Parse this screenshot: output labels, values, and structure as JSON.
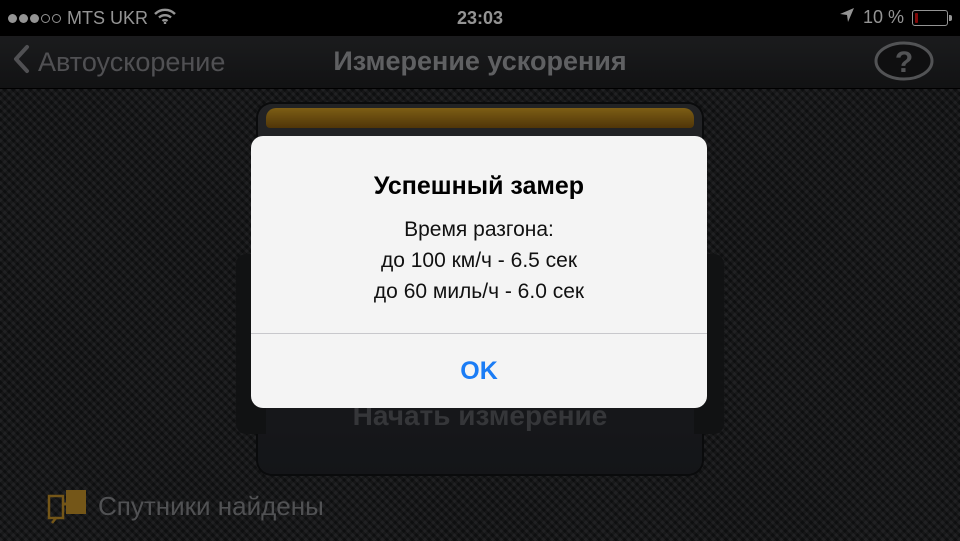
{
  "status_bar": {
    "carrier": "MTS UKR",
    "time": "23:03",
    "battery_percent": "10 %",
    "battery_level": 0.1,
    "signal_bars_filled": 3,
    "signal_bars_total": 5
  },
  "nav": {
    "back_label": "Автоускорение",
    "title": "Измерение ускорения"
  },
  "panel": {
    "start_button": "Начать измерение"
  },
  "footer": {
    "satellites_label": "Спутники найдены"
  },
  "alert": {
    "title": "Успешный замер",
    "line1": "Время разгона:",
    "line2": "до 100 км/ч - 6.5 сек",
    "line3": "до 60 миль/ч - 6.0 сек",
    "ok_label": "OK"
  },
  "icons": {
    "wifi": "wifi-icon",
    "location": "location-arrow-icon",
    "battery": "battery-icon",
    "back": "chevron-left-icon",
    "help": "question-icon",
    "satellite": "satellite-icon"
  },
  "colors": {
    "accent_blue": "#1a7cf5",
    "battery_red": "#e11111",
    "gold": "#d7a224"
  }
}
